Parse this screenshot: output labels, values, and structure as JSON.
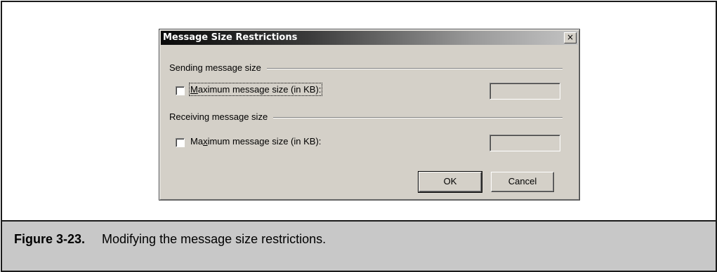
{
  "dialog": {
    "title": "Message Size Restrictions",
    "close_glyph": "×",
    "sending": {
      "group_label": "Sending message size",
      "checkbox_checked": false,
      "label_pre": "",
      "label_key": "M",
      "label_post": "aximum message size (in KB):",
      "value": ""
    },
    "receiving": {
      "group_label": "Receiving message size",
      "checkbox_checked": false,
      "label_pre": "Ma",
      "label_key": "x",
      "label_post": "imum message size (in KB):",
      "value": ""
    },
    "ok_label": "OK",
    "cancel_label": "Cancel"
  },
  "caption": {
    "figure_number": "Figure 3-23.",
    "text": "Modifying the message size restrictions."
  }
}
